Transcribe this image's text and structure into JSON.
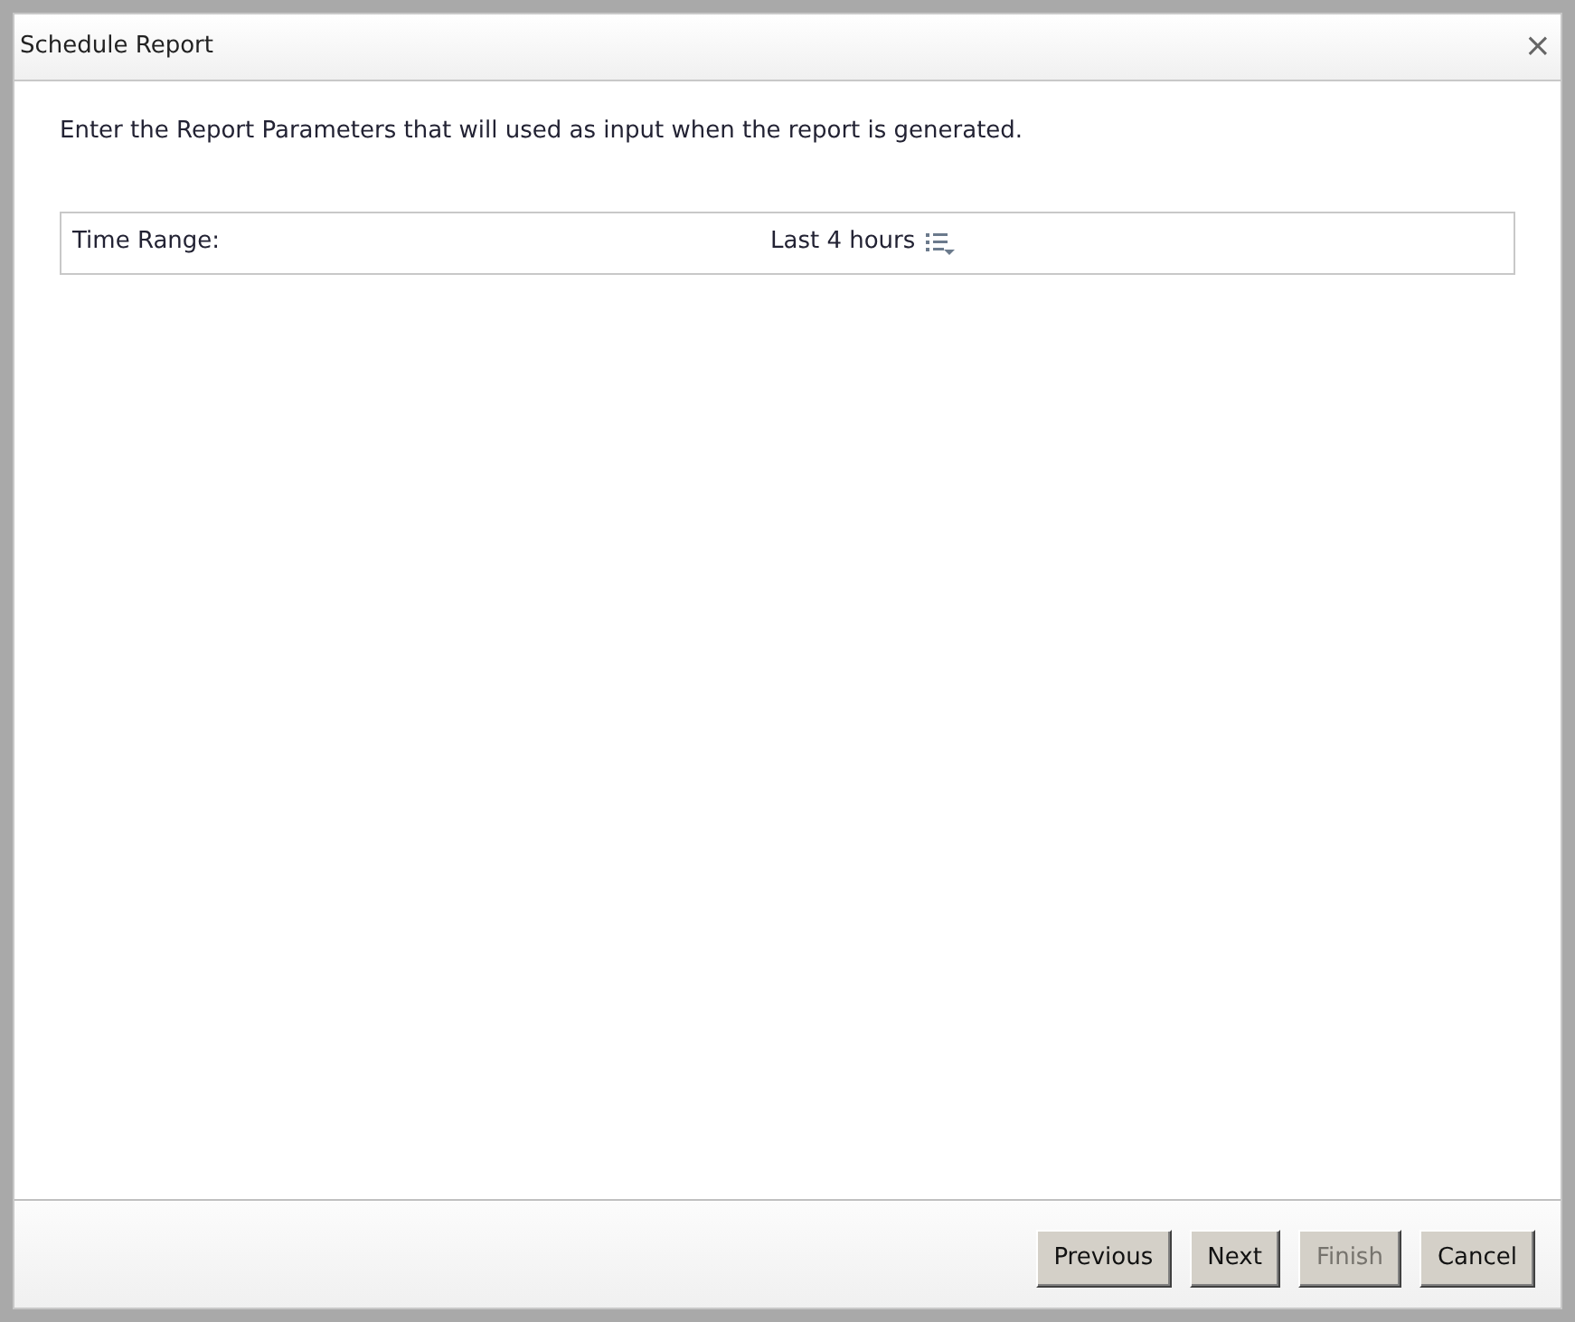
{
  "window": {
    "title": "Schedule Report",
    "close": "×"
  },
  "intro": "Enter the Report Parameters that will used as input when the report is generated.",
  "parameters": [
    {
      "label": "Time Range:",
      "value": "Last 4 hours"
    }
  ],
  "buttons": [
    {
      "label": "Previous",
      "disabled": false
    },
    {
      "label": "Next",
      "disabled": false
    },
    {
      "label": "Finish",
      "disabled": true
    },
    {
      "label": "Cancel",
      "disabled": false
    }
  ]
}
